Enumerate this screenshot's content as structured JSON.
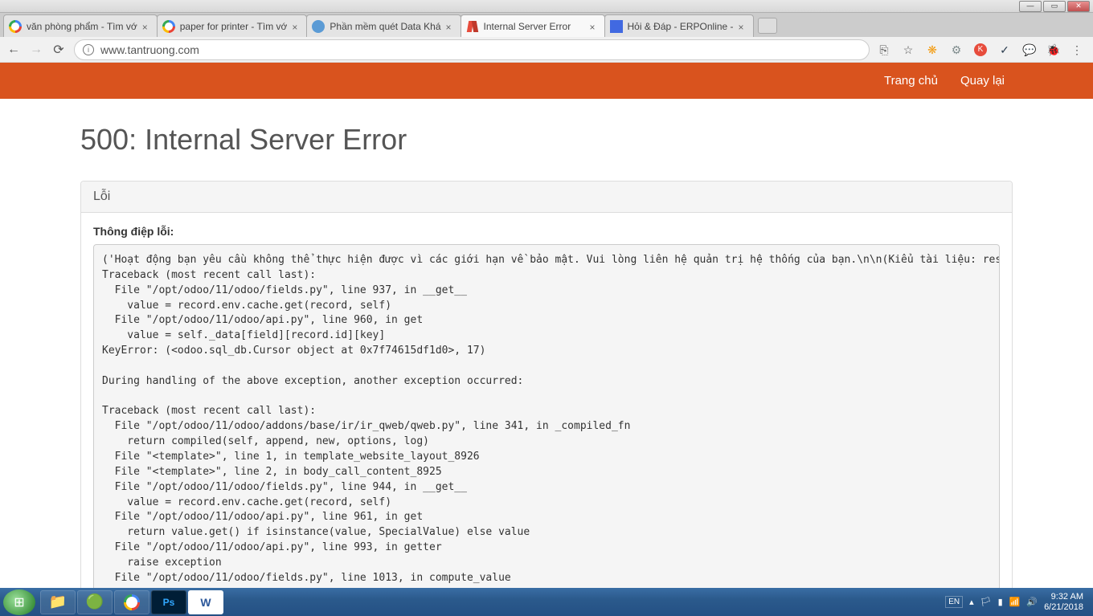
{
  "browser": {
    "tabs": [
      {
        "title": "văn phòng phẩm - Tìm vớ",
        "favicon": "google"
      },
      {
        "title": "paper for printer - Tìm vớ",
        "favicon": "google"
      },
      {
        "title": "Phần mềm quét Data Khá",
        "favicon": "blue"
      },
      {
        "title": "Internal Server Error",
        "favicon": "red",
        "active": true
      },
      {
        "title": "Hỏi & Đáp - ERPOnline -",
        "favicon": "square"
      }
    ],
    "url": "www.tantruong.com"
  },
  "nav": {
    "home": "Trang chủ",
    "back": "Quay lại"
  },
  "error": {
    "title": "500: Internal Server Error",
    "panel_title": "Lỗi",
    "message_label": "Thông điệp lỗi:",
    "trace": "('Hoạt động bạn yêu cầu không thể thực hiện được vì các giới hạn về bảo mật. Vui lòng liên hệ quản trị hệ thống của bạn.\\n\\n(Kiểu tài liệu: res.users, Hoạ\nTraceback (most recent call last):\n  File \"/opt/odoo/11/odoo/fields.py\", line 937, in __get__\n    value = record.env.cache.get(record, self)\n  File \"/opt/odoo/11/odoo/api.py\", line 960, in get\n    value = self._data[field][record.id][key]\nKeyError: (<odoo.sql_db.Cursor object at 0x7f74615df1d0>, 17)\n\nDuring handling of the above exception, another exception occurred:\n\nTraceback (most recent call last):\n  File \"/opt/odoo/11/odoo/addons/base/ir/ir_qweb/qweb.py\", line 341, in _compiled_fn\n    return compiled(self, append, new, options, log)\n  File \"<template>\", line 1, in template_website_layout_8926\n  File \"<template>\", line 2, in body_call_content_8925\n  File \"/opt/odoo/11/odoo/fields.py\", line 944, in __get__\n    value = record.env.cache.get(record, self)\n  File \"/opt/odoo/11/odoo/api.py\", line 961, in get\n    return value.get() if isinstance(value, SpecialValue) else value\n  File \"/opt/odoo/11/odoo/api.py\", line 993, in getter\n    raise exception\n  File \"/opt/odoo/11/odoo/fields.py\", line 1013, in compute_value\n    self._compute_value(record)"
  },
  "taskbar": {
    "lang": "EN",
    "time": "9:32 AM",
    "date": "6/21/2018"
  }
}
